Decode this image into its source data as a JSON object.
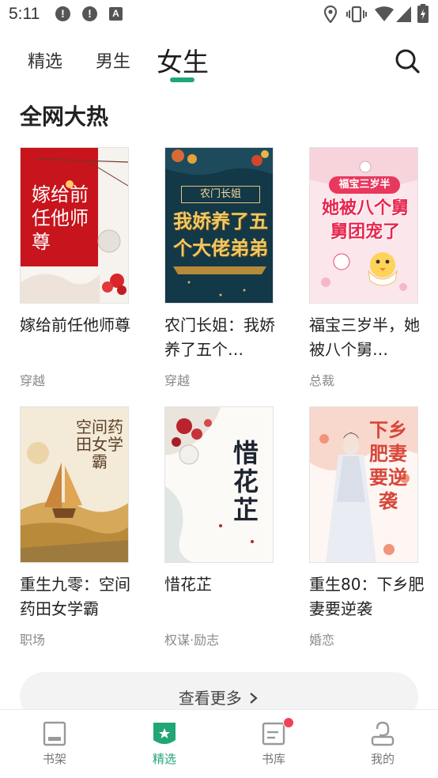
{
  "status_bar": {
    "time": "5:11",
    "a_label": "A",
    "alert_glyph": "!"
  },
  "tabs": [
    {
      "label": "精选"
    },
    {
      "label": "男生"
    },
    {
      "label": "女生",
      "active": true
    }
  ],
  "section": {
    "title": "全网大热"
  },
  "books": [
    {
      "title": "嫁给前任他师尊",
      "tag": "穿越",
      "cover_text": "嫁给前任他师尊"
    },
    {
      "title": "农门长姐：我娇养了五个…",
      "tag": "穿越",
      "cover_text_top": "农门长姐",
      "cover_text_main": "我娇养了五个大佬弟弟"
    },
    {
      "title": "福宝三岁半，她被八个舅…",
      "tag": "总裁",
      "cover_text_top": "福宝三岁半",
      "cover_text_main": "她被八个舅舅团宠了"
    },
    {
      "title": "重生九零：空间药田女学霸",
      "tag": "职场",
      "cover_text": "空间药田女学霸"
    },
    {
      "title": "惜花芷",
      "tag": "权谋·励志",
      "cover_text": "惜花芷"
    },
    {
      "title": "重生80：下乡肥妻要逆袭",
      "tag": "婚恋",
      "cover_text": "下乡肥妻要逆袭"
    }
  ],
  "more_button": {
    "label": "查看更多"
  },
  "bottom_nav": [
    {
      "label": "书架",
      "icon": "bookshelf-icon"
    },
    {
      "label": "精选",
      "icon": "featured-icon",
      "active": true
    },
    {
      "label": "书库",
      "icon": "library-icon",
      "badge": true
    },
    {
      "label": "我的",
      "icon": "profile-icon"
    }
  ],
  "colors": {
    "accent": "#21a676",
    "badge": "#ee4455"
  }
}
